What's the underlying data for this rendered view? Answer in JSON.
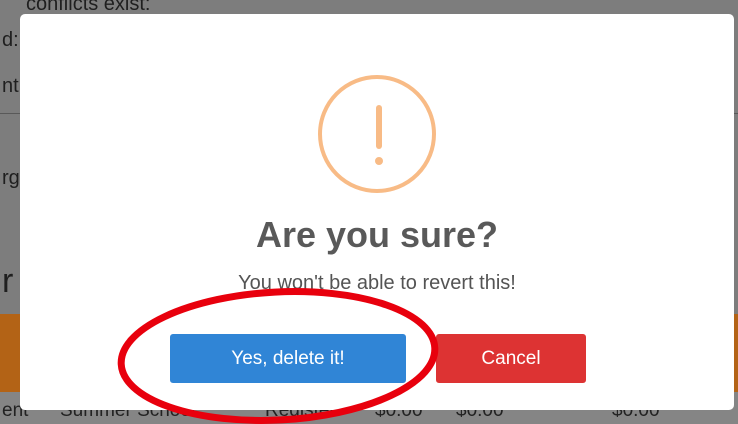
{
  "background": {
    "line1": "conflicts exist:",
    "line2": "d:",
    "line3": "nt",
    "line4": "rg",
    "line5": "r",
    "row": {
      "col1": "ent",
      "col2": "Summer School",
      "col3": "Register",
      "col4": "$0.00",
      "col5": "$0.00",
      "col6": "$0.00"
    }
  },
  "dialog": {
    "icon": "warning-icon",
    "title": "Are you sure?",
    "text": "You won't be able to revert this!",
    "confirm_label": "Yes, delete it!",
    "cancel_label": "Cancel"
  },
  "colors": {
    "confirm": "#3085d6",
    "cancel": "#dd3333",
    "warning": "#f8bb86",
    "highlight": "#e8000d"
  }
}
